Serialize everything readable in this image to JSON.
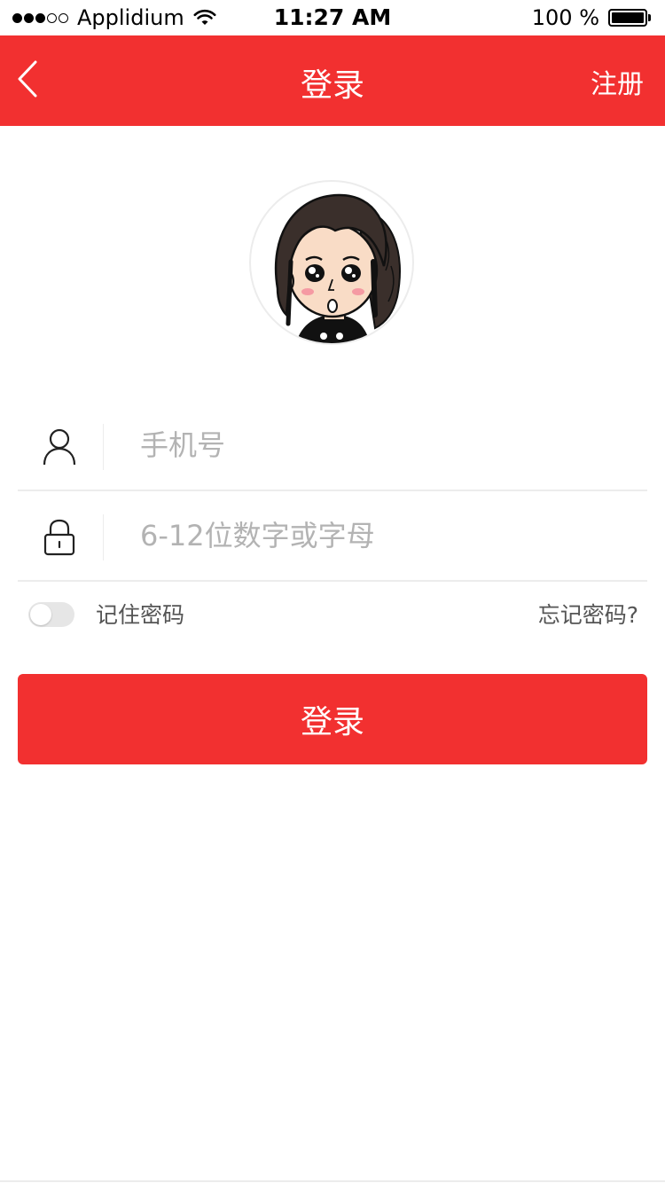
{
  "status_bar": {
    "carrier": "Applidium",
    "time": "11:27 AM",
    "battery": "100 %",
    "signal_filled": 3,
    "signal_total": 5
  },
  "nav": {
    "title": "登录",
    "register": "注册",
    "back_icon": "chevron-left-icon",
    "background": "#f23030"
  },
  "avatar": {
    "icon": "cartoon-girl-avatar"
  },
  "form": {
    "phone_placeholder": "手机号",
    "phone_icon": "user-icon",
    "password_placeholder": "6-12位数字或字母",
    "password_icon": "lock-icon"
  },
  "options": {
    "remember_label": "记住密码",
    "remember_on": false,
    "forgot_label": "忘记密码?"
  },
  "login_button": {
    "label": "登录"
  },
  "colors": {
    "accent": "#f23030",
    "divider": "#ececec",
    "placeholder": "#b3b3b3"
  }
}
